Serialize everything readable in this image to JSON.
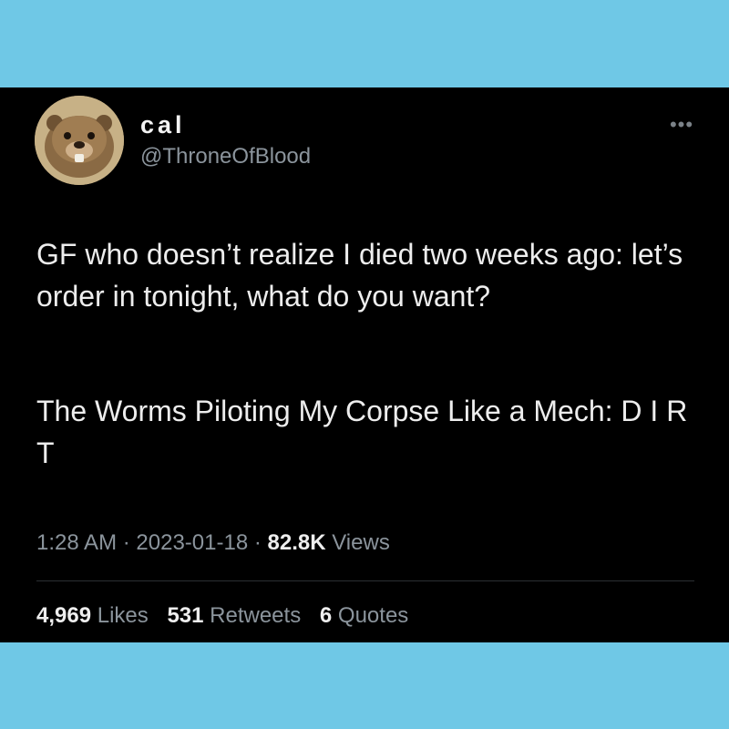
{
  "tweet": {
    "display_name": "cal",
    "handle": "@ThroneOfBlood",
    "more_icon": "more-options-icon",
    "paragraphs": [
      "GF who doesn’t realize I died two weeks ago: let’s order in tonight, what do you want?",
      "The Worms Piloting My Corpse Like a Mech: D I R T"
    ],
    "time": "1:28 AM",
    "date": "2023-01-18",
    "views_count": "82.8K",
    "views_label": "Views",
    "separator": "·",
    "stats": [
      {
        "count": "4,969",
        "label": "Likes"
      },
      {
        "count": "531",
        "label": "Retweets"
      },
      {
        "count": "6",
        "label": "Quotes"
      }
    ]
  },
  "colors": {
    "background_band": "#6fc8e6",
    "tweet_background": "#000000",
    "secondary_text": "#8b949c"
  }
}
